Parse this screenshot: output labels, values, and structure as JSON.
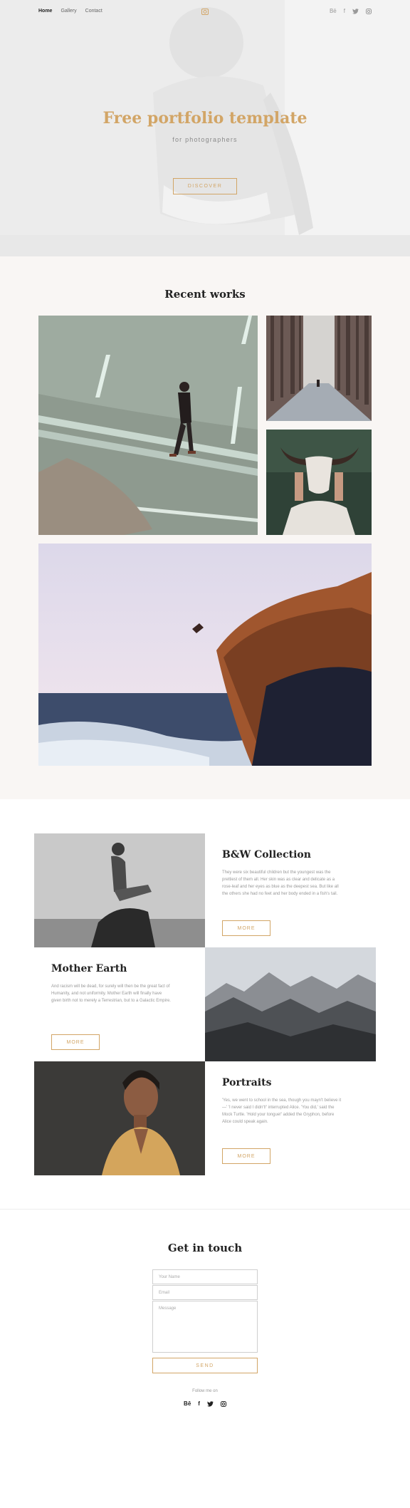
{
  "nav": {
    "items": [
      "Home",
      "Gallery",
      "Contact"
    ]
  },
  "social": {
    "behance": "Bē",
    "facebook": "f"
  },
  "hero": {
    "title": "Free portfolio template",
    "subtitle": "for photographers",
    "button": "DISCOVER"
  },
  "works": {
    "title": "Recent works"
  },
  "collections": [
    {
      "title": "B&W Collection",
      "text": "They were six beautiful children but the youngest was the prettiest of them all. Her skin was as clear and delicate as a rose-leaf and her eyes as blue as the deepest sea. But like all the others she had no feet and her body ended in a fish's tail.",
      "button": "MORE"
    },
    {
      "title": "Mother Earth",
      "text": "And racism will be dead, for surely will then be the great fact of Humanity, and not uniformity. Mother Earth will finally have given birth not to merely a Terrestrian, but to a Galactic Empire.",
      "button": "MORE"
    },
    {
      "title": "Portraits",
      "text": "'Yes, we went to school in the sea, though you mayn't believe it—' 'I never said I didn't!' interrupted Alice. 'You did,' said the Mock Turtle. 'Hold your tongue!' added the Gryphon, before Alice could speak again.",
      "button": "MORE"
    }
  ],
  "contact": {
    "title": "Get in touch",
    "name_placeholder": "Your Name",
    "email_placeholder": "Email",
    "message_placeholder": "Message",
    "send": "SEND",
    "follow": "Follow me on"
  },
  "colors": {
    "accent": "#d2a566",
    "section_bg": "#f9f6f4"
  }
}
